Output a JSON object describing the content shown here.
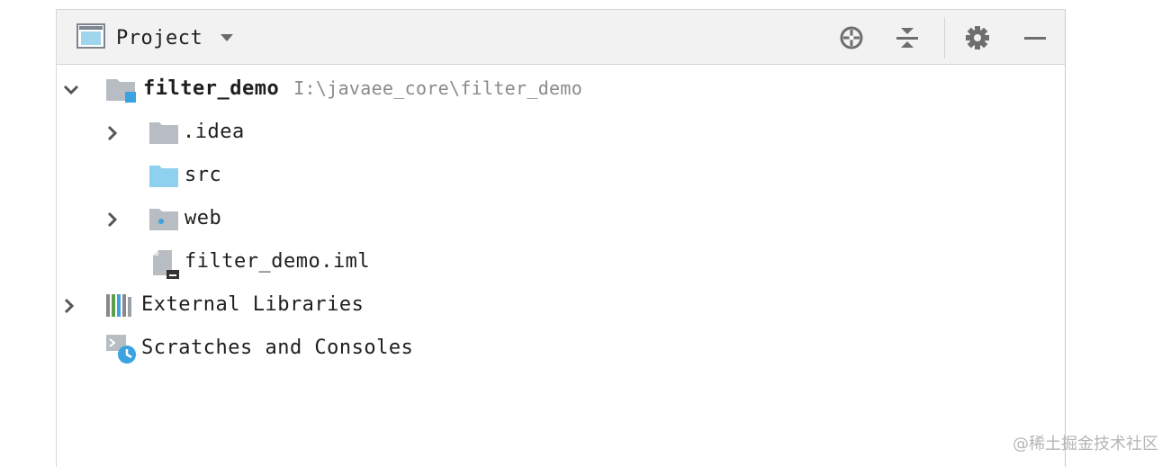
{
  "panel": {
    "title": "Project"
  },
  "toolbar": {
    "icons": [
      "crosshair-icon",
      "collapse-all-icon",
      "gear-icon",
      "minimize-icon"
    ]
  },
  "tree": {
    "root": {
      "name": "filter_demo",
      "path": "I:\\javaee_core\\filter_demo",
      "expanded": true
    },
    "children": [
      {
        "name": ".idea",
        "icon": "folder-icon",
        "expandable": true
      },
      {
        "name": "src",
        "icon": "source-folder-icon",
        "expandable": false
      },
      {
        "name": "web",
        "icon": "web-folder-icon",
        "expandable": true
      },
      {
        "name": "filter_demo.iml",
        "icon": "iml-file-icon",
        "expandable": false
      }
    ],
    "external_libraries": {
      "name": "External Libraries",
      "expandable": true
    },
    "scratches": {
      "name": "Scratches and Consoles"
    }
  },
  "watermark": "@稀土掘金技术社区",
  "colors": {
    "folder_gray": "#b7bdc3",
    "folder_blue": "#8ed1ef",
    "accent_blue": "#3aa3e0",
    "toolbar_bg": "#f2f2f2"
  }
}
